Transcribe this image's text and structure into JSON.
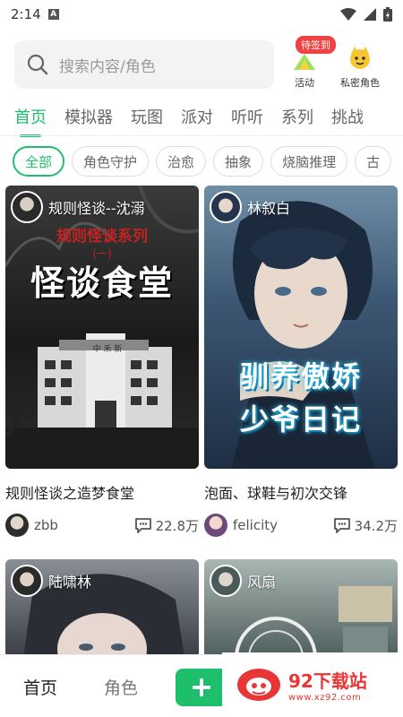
{
  "status_bar": {
    "time": "2:14",
    "notif_icon": "A"
  },
  "search": {
    "placeholder": "搜索内容/角色"
  },
  "quick_actions": [
    {
      "label": "活动",
      "badge": "待签到",
      "icon": "activity-icon"
    },
    {
      "label": "私密角色",
      "icon": "private-character-icon"
    }
  ],
  "tabs": [
    "首页",
    "模拟器",
    "玩图",
    "派对",
    "听听",
    "系列",
    "挑战"
  ],
  "chips": [
    "全部",
    "角色守护",
    "治愈",
    "抽象",
    "烧脑推理",
    "古"
  ],
  "cards": [
    {
      "author": "规则怪谈--沈溺",
      "cover_text_top": "规则怪谈系列",
      "cover_text_sub": "(一)",
      "cover_text_main": "怪谈食堂",
      "building_sign": "中 禾 新",
      "title": "规则怪谈之造梦食堂",
      "user": "zbb",
      "stat": "22.8万"
    },
    {
      "author": "林叙白",
      "cover_text_main": "驯养傲娇",
      "cover_text_sub": "少爷日记",
      "title": "泡面、球鞋与初次交锋",
      "user": "felicity",
      "stat": "34.2万"
    },
    {
      "author": "陆啸林"
    },
    {
      "author": "风扇"
    }
  ],
  "bottom_nav": {
    "home": "首页",
    "character": "角色"
  },
  "watermark": {
    "title": "92下载站",
    "url": "www.xz92.com"
  },
  "colors": {
    "accent": "#1dbf6d",
    "badge": "#f04242"
  }
}
